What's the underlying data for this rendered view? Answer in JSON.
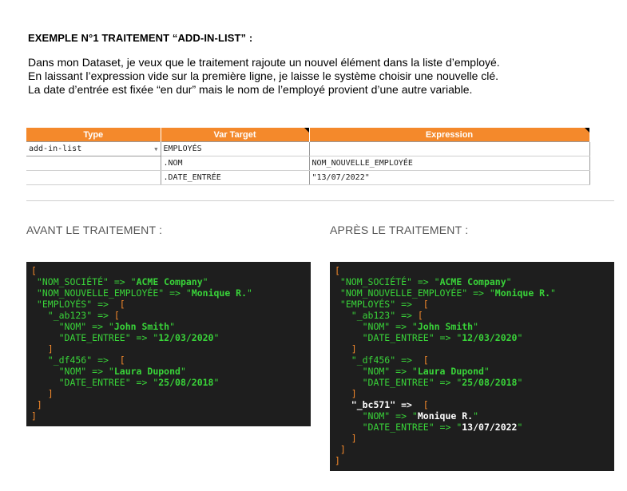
{
  "title": "EXEMPLE N°1 TRAITEMENT “ADD-IN-LIST” :",
  "description": [
    "Dans mon Dataset, je veux que le traitement rajoute un nouvel élément dans la liste d’employé.",
    "En laissant l’expression vide sur la première ligne, je laisse le système choisir une nouvelle clé.",
    "La date d’entrée est fixée “en dur” mais le nom de l’employé provient d’une autre variable."
  ],
  "sheet": {
    "headers": [
      "Type",
      "Var Target",
      "Expression"
    ],
    "rows": [
      [
        "add-in-list",
        "EMPLOYÉS",
        ""
      ],
      [
        "",
        ".NOM",
        "NOM_NOUVELLE_EMPLOYÉE"
      ],
      [
        "",
        ".DATE_ENTRÉE",
        "\"13/07/2022\""
      ]
    ]
  },
  "before_label": "AVANT LE TRAITEMENT :",
  "after_label": "APRÈS LE TRAITEMENT :",
  "code_before": [
    [
      [
        "b",
        "["
      ]
    ],
    [
      [
        "s",
        " \"NOM_SOCIÉTÉ\" => \""
      ],
      [
        "sv",
        "ACME Company"
      ],
      [
        "s",
        "\""
      ]
    ],
    [
      [
        "s",
        " \"NOM_NOUVELLE_EMPLOYÉE\" => \""
      ],
      [
        "sv",
        "Monique R."
      ],
      [
        "s",
        "\""
      ]
    ],
    [
      [
        "s",
        " \"EMPLOYÉS\" =>  "
      ],
      [
        "b",
        "["
      ]
    ],
    [
      [
        "s",
        "   \"_ab123\" => "
      ],
      [
        "b",
        "["
      ]
    ],
    [
      [
        "s",
        "     \"NOM\" => \""
      ],
      [
        "sv",
        "John Smith"
      ],
      [
        "s",
        "\""
      ]
    ],
    [
      [
        "s",
        "     \"DATE_ENTREE\" => \""
      ],
      [
        "sv",
        "12/03/2020"
      ],
      [
        "s",
        "\""
      ]
    ],
    [
      [
        "b",
        "   ]"
      ]
    ],
    [
      [
        "s",
        "   \"_df456\" =>  "
      ],
      [
        "b",
        "["
      ]
    ],
    [
      [
        "s",
        "     \"NOM\" => \""
      ],
      [
        "sv",
        "Laura Dupond"
      ],
      [
        "s",
        "\""
      ]
    ],
    [
      [
        "s",
        "     \"DATE_ENTREE\" => \""
      ],
      [
        "sv",
        "25/08/2018"
      ],
      [
        "s",
        "\""
      ]
    ],
    [
      [
        "b",
        "   ]"
      ]
    ],
    [
      [
        "b",
        " ]"
      ]
    ],
    [
      [
        "b",
        "]"
      ]
    ]
  ],
  "code_after": [
    [
      [
        "b",
        "["
      ]
    ],
    [
      [
        "s",
        " \"NOM_SOCIÉTÉ\" => \""
      ],
      [
        "sv",
        "ACME Company"
      ],
      [
        "s",
        "\""
      ]
    ],
    [
      [
        "s",
        " \"NOM_NOUVELLE_EMPLOYÉE\" => \""
      ],
      [
        "sv",
        "Monique R."
      ],
      [
        "s",
        "\""
      ]
    ],
    [
      [
        "s",
        " \"EMPLOYÉS\" =>  "
      ],
      [
        "b",
        "["
      ]
    ],
    [
      [
        "s",
        "   \"_ab123\" => "
      ],
      [
        "b",
        "["
      ]
    ],
    [
      [
        "s",
        "     \"NOM\" => \""
      ],
      [
        "sv",
        "John Smith"
      ],
      [
        "s",
        "\""
      ]
    ],
    [
      [
        "s",
        "     \"DATE_ENTREE\" => \""
      ],
      [
        "sv",
        "12/03/2020"
      ],
      [
        "s",
        "\""
      ]
    ],
    [
      [
        "b",
        "   ]"
      ]
    ],
    [
      [
        "s",
        "   \"_df456\" =>  "
      ],
      [
        "b",
        "["
      ]
    ],
    [
      [
        "s",
        "     \"NOM\" => \""
      ],
      [
        "sv",
        "Laura Dupond"
      ],
      [
        "s",
        "\""
      ]
    ],
    [
      [
        "s",
        "     \"DATE_ENTREE\" => \""
      ],
      [
        "sv",
        "25/08/2018"
      ],
      [
        "s",
        "\""
      ]
    ],
    [
      [
        "b",
        "   ]"
      ]
    ],
    [
      [
        "w",
        "   \"_bc571\" =>  "
      ],
      [
        "b",
        "["
      ]
    ],
    [
      [
        "s",
        "     \"NOM\" => \""
      ],
      [
        "w",
        "Monique R."
      ],
      [
        "s",
        "\""
      ]
    ],
    [
      [
        "s",
        "     \"DATE_ENTREE\" => \""
      ],
      [
        "w",
        "13/07/2022"
      ],
      [
        "s",
        "\""
      ]
    ],
    [
      [
        "b",
        "   ]"
      ]
    ],
    [
      [
        "b",
        " ]"
      ]
    ],
    [
      [
        "b",
        "]"
      ]
    ]
  ]
}
